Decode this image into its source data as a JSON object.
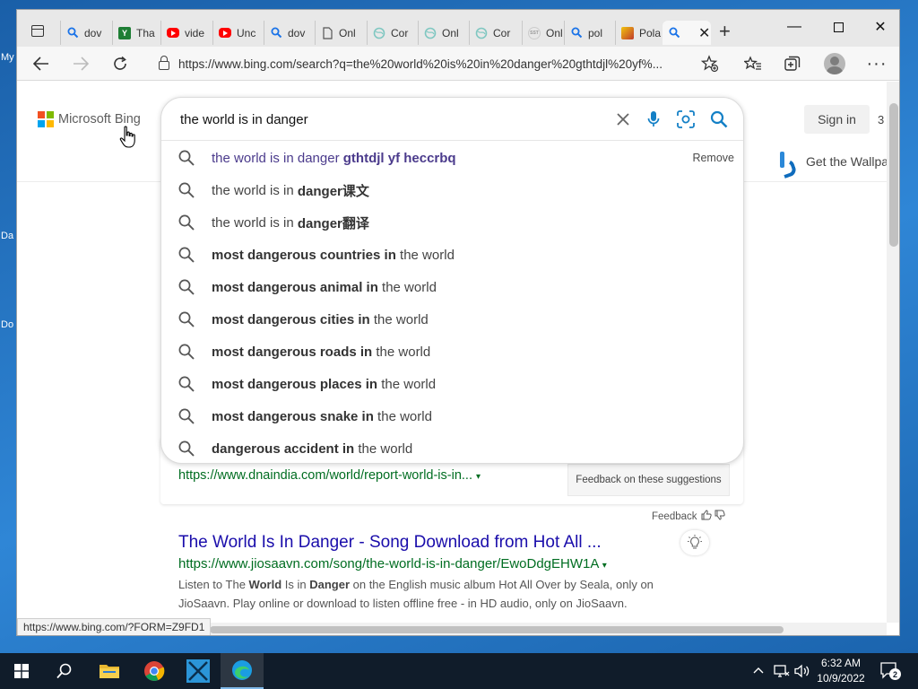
{
  "desktop": {
    "labels": [
      "My",
      "Da",
      "Do"
    ]
  },
  "browser": {
    "tabs": [
      {
        "label": "dov",
        "icon": "search-icon",
        "color": "#1a73e8"
      },
      {
        "label": "Tha",
        "icon": "sheets-icon",
        "color": "#1e7e34"
      },
      {
        "label": "vide",
        "icon": "youtube-icon",
        "color": "#ff0000"
      },
      {
        "label": "Unc",
        "icon": "youtube-icon",
        "color": "#ff0000"
      },
      {
        "label": "dov",
        "icon": "search-icon",
        "color": "#1a73e8"
      },
      {
        "label": "Onl",
        "icon": "page-icon",
        "color": "#555555"
      },
      {
        "label": "Cor",
        "icon": "web-icon",
        "color": "#7fc7c1"
      },
      {
        "label": "Onl",
        "icon": "web-icon",
        "color": "#7fc7c1"
      },
      {
        "label": "Cor",
        "icon": "web-icon",
        "color": "#7fc7c1"
      },
      {
        "label": "Onl",
        "icon": "sst-icon",
        "color": "#999999"
      },
      {
        "label": "pol",
        "icon": "search-icon",
        "color": "#1a73e8"
      },
      {
        "label": "Pola",
        "icon": "game-icon",
        "color": "#c0392b"
      }
    ],
    "active_tab_icon": "search-icon",
    "address_url": "https://www.bing.com/search?q=the%20world%20is%20in%20danger%20gthtdjl%20yf%..."
  },
  "bing": {
    "logo_text": "Microsoft Bing",
    "logo_colors": [
      "#f25022",
      "#7fba00",
      "#00a4ef",
      "#ffb900"
    ],
    "sign_in_label": "Sign in",
    "points": "3",
    "wallpaper_promo": "Get the Wallpa",
    "query": "the world is in danger",
    "remove_label": "Remove",
    "suggestions": [
      {
        "plain": "the world is in danger ",
        "bold": "gthtdjl yf heccrbq",
        "history": true
      },
      {
        "plain": "the world is in ",
        "bold": "danger课文"
      },
      {
        "plain": "the world is in ",
        "bold": "danger翻译"
      },
      {
        "bold": "most dangerous countries in",
        "plain": " the world"
      },
      {
        "bold": "most dangerous animal in",
        "plain": " the world"
      },
      {
        "bold": "most dangerous cities in",
        "plain": " the world"
      },
      {
        "bold": "most dangerous roads in",
        "plain": " the world"
      },
      {
        "bold": "most dangerous places in",
        "plain": " the world"
      },
      {
        "bold": "most dangerous snake in",
        "plain": " the world"
      },
      {
        "bold": "dangerous accident in",
        "plain": " the world"
      }
    ],
    "card_url": "https://www.dnaindia.com/world/report-world-is-in...",
    "feedback_suggestions_label": "Feedback on these suggestions",
    "feedback_label": "Feedback",
    "result": {
      "title": "The World Is In Danger - Song Download from Hot All ...",
      "url": "https://www.jiosaavn.com/song/the-world-is-in-danger/EwoDdgEHW1A",
      "snippet_parts": [
        {
          "t": "Listen to The "
        },
        {
          "t": "World",
          "b": true
        },
        {
          "t": " Is in "
        },
        {
          "t": "Danger",
          "b": true
        },
        {
          "t": " on the English music album Hot All Over by Seala, only on JioSaavn. Play online or download to listen offline free - in HD audio, only on JioSaavn."
        }
      ]
    },
    "status_url": "https://www.bing.com/?FORM=Z9FD1"
  },
  "taskbar": {
    "time": "6:32 AM",
    "date": "10/9/2022",
    "notification_count": "2"
  }
}
